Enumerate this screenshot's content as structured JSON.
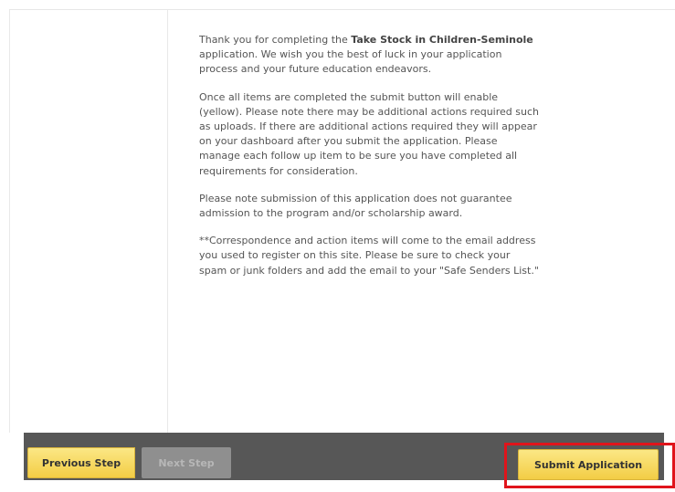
{
  "message": {
    "p1_before": "Thank you for completing the ",
    "p1_bold": "Take Stock in Children-Seminole",
    "p1_after": " application. We wish you the best of luck in your application process and your future education endeavors.",
    "p2": "Once all items are completed the submit button will enable (yellow). Please note there may be additional actions required such as uploads. If there are additional actions required they will appear on your dashboard after you submit the application. Please manage each follow up item to be sure you have completed all requirements for consideration.",
    "p3": "Please note submission of this application does not guarantee admission to the program and/or scholarship award.",
    "p4": "**Correspondence and action items will come to the email address you used to register on this site. Please be sure to check your spam or junk folders and add the email to your \"Safe Senders List.\""
  },
  "footer": {
    "previous_label": "Previous Step",
    "next_label": "Next Step",
    "submit_label": "Submit Application"
  },
  "colors": {
    "button_yellow": "#f3cd45",
    "button_disabled": "#8f8f8f",
    "footer_bar": "#575757",
    "highlight_red": "#e0141b"
  }
}
